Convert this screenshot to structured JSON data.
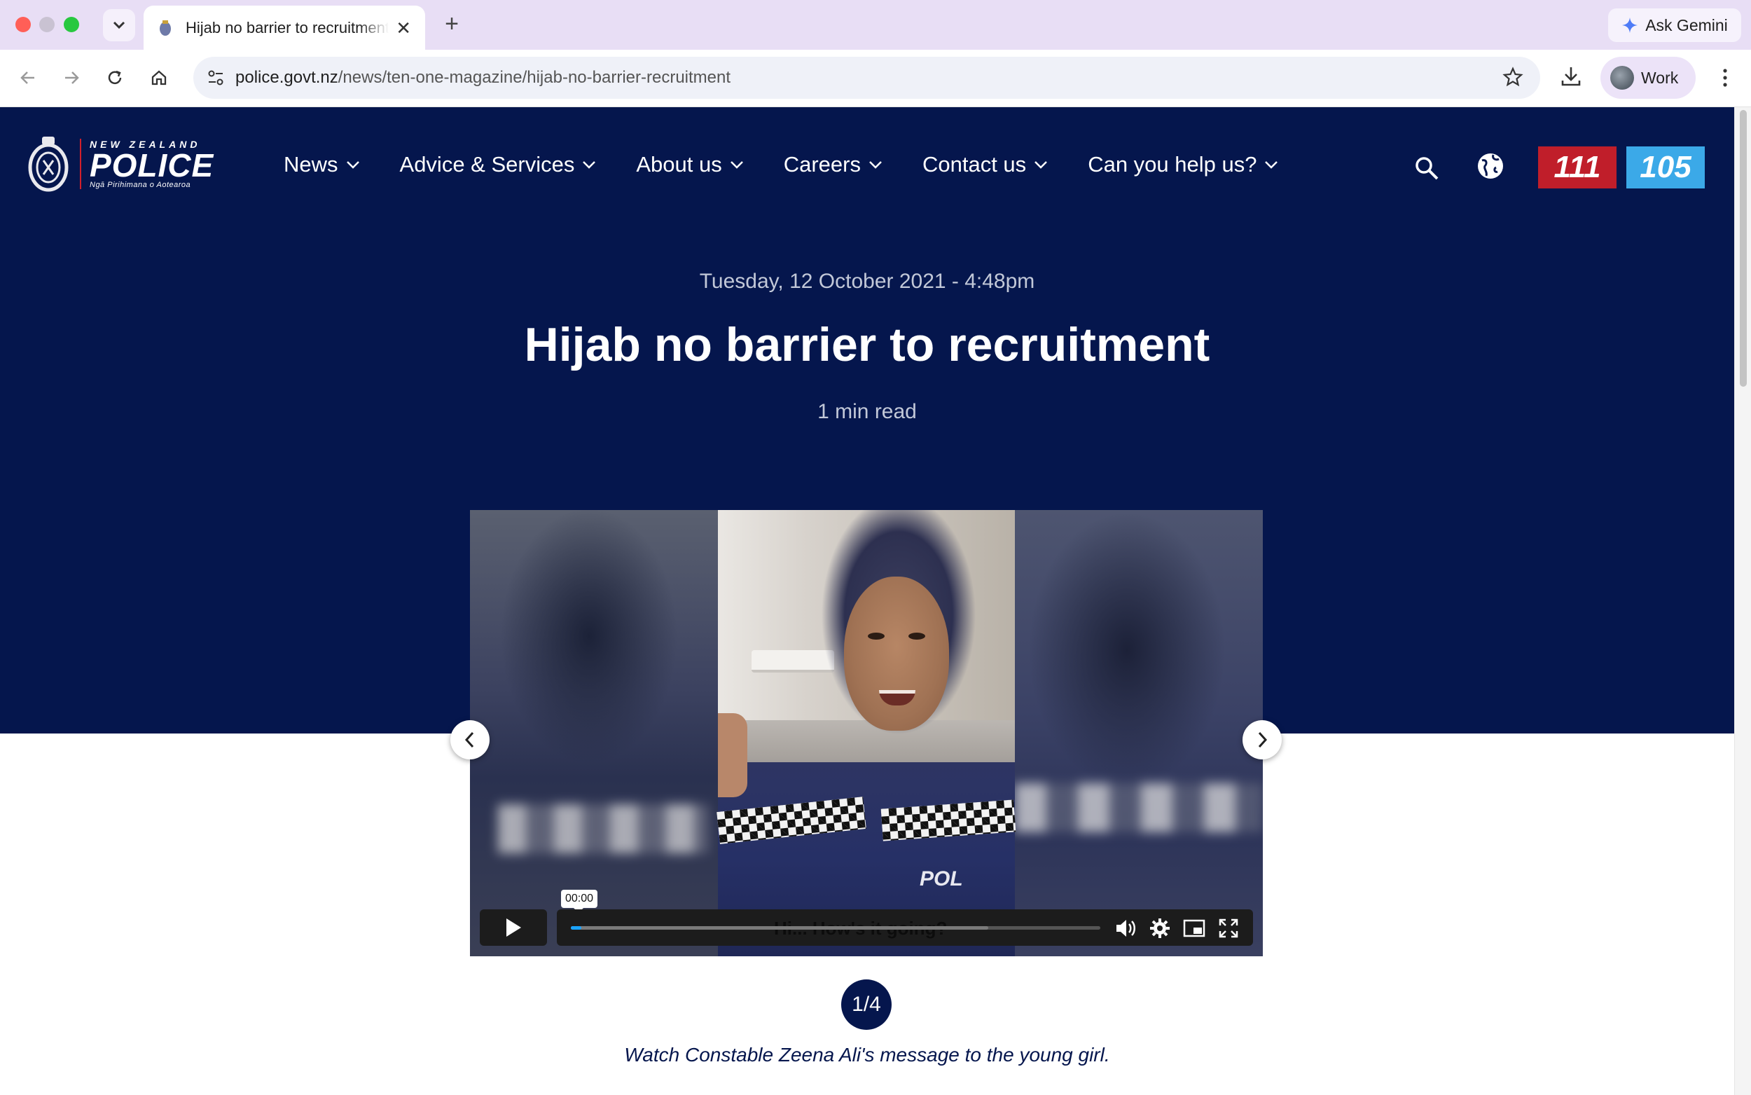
{
  "browser": {
    "tab_title": "Hijab no barrier to recruitment",
    "tab_close": "✕",
    "new_tab": "+",
    "gemini_label": "Ask Gemini",
    "url_host": "police.govt.nz",
    "url_path": "/news/ten-one-magazine/hijab-no-barrier-recruitment",
    "profile_label": "Work"
  },
  "site": {
    "logo": {
      "top": "NEW ZEALAND",
      "main": "POLICE",
      "sub": "Ngā Pirihimana o Aotearoa"
    },
    "nav": [
      {
        "label": "News"
      },
      {
        "label": "Advice & Services"
      },
      {
        "label": "About us"
      },
      {
        "label": "Careers"
      },
      {
        "label": "Contact us"
      },
      {
        "label": "Can you help us?"
      }
    ],
    "emergency": "111",
    "non_emergency": "105",
    "colors": {
      "navy": "#05164d",
      "emergency_red": "#c01e2a",
      "non_emergency_blue": "#3ba9e8"
    }
  },
  "article": {
    "date": "Tuesday, 12 October 2021 - 4:48pm",
    "title": "Hijab no barrier to recruitment",
    "read_time": "1 min read"
  },
  "video": {
    "time_tooltip": "00:00",
    "caption_overlay": "Hi... How's it going?",
    "progress_fraction": 0.02,
    "badge_text": "POL"
  },
  "carousel": {
    "counter": "1/4",
    "caption": "Watch Constable Zeena Ali's message to the young girl."
  }
}
